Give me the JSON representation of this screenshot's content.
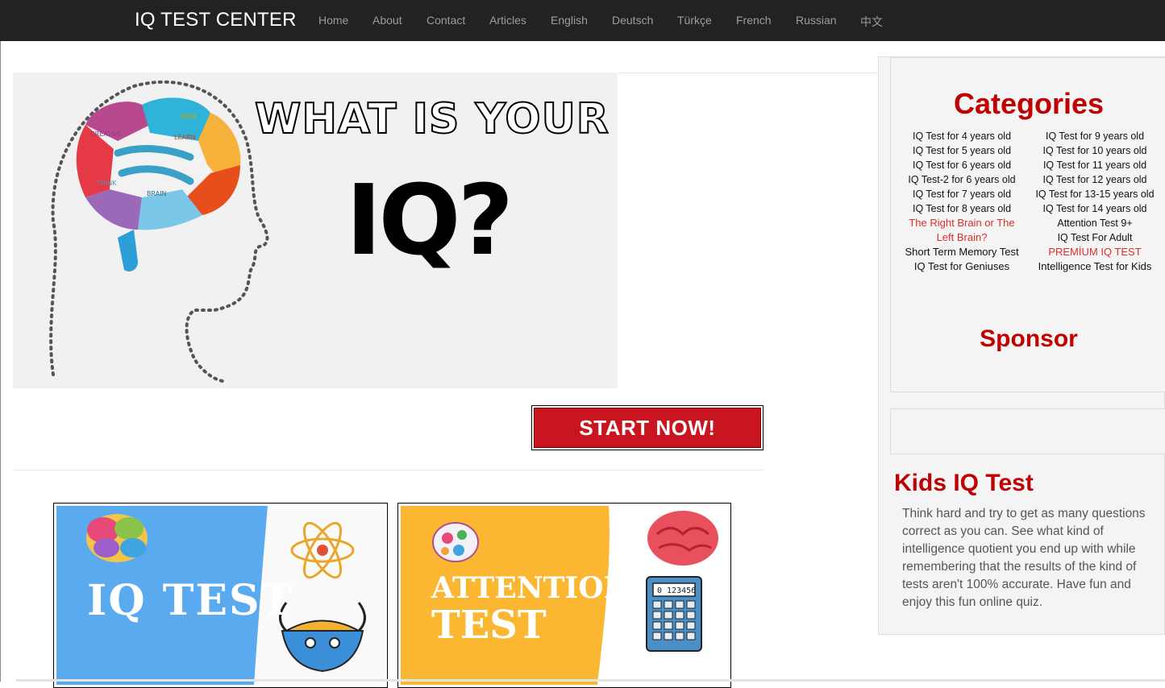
{
  "navbar": {
    "brand": "IQ TEST CENTER",
    "links": [
      "Home",
      "About",
      "Contact",
      "Articles",
      "English",
      "Deutsch",
      "Türkçe",
      "French",
      "Russian",
      "中文"
    ]
  },
  "hero": {
    "headline": "WHAT IS YOUR",
    "iq": "IQ?",
    "brain_labels": [
      "IDEA",
      "CREATIVE",
      "LEARN",
      "THINK",
      "BRAIN"
    ]
  },
  "start_button": {
    "label": "START NOW!"
  },
  "cards": [
    {
      "title_line1": "IQ TEST",
      "title_line2": ""
    },
    {
      "title_line1": "ATTENTION",
      "title_line2": "TEST",
      "calculator_display": "0 123456"
    }
  ],
  "sidebar": {
    "categories_heading": "Categories",
    "left_column": [
      {
        "label": "IQ Test for 4 years old",
        "highlight": false
      },
      {
        "label": "IQ Test for 5 years old",
        "highlight": false
      },
      {
        "label": "IQ Test for 6 years old",
        "highlight": false
      },
      {
        "label": "IQ Test-2 for 6 years old",
        "highlight": false
      },
      {
        "label": "IQ Test for 7 years old",
        "highlight": false
      },
      {
        "label": "IQ Test for 8 years old",
        "highlight": false
      },
      {
        "label": "The Right Brain or The Left Brain?",
        "highlight": true
      },
      {
        "label": "Short Term Memory Test",
        "highlight": false
      },
      {
        "label": "IQ Test for Geniuses",
        "highlight": false
      }
    ],
    "right_column": [
      {
        "label": "IQ Test for 9 years old",
        "highlight": false
      },
      {
        "label": "IQ Test for 10 years old",
        "highlight": false
      },
      {
        "label": "IQ Test for 11 years old",
        "highlight": false
      },
      {
        "label": "IQ Test for 12 years old",
        "highlight": false
      },
      {
        "label": "IQ Test for 13-15 years old",
        "highlight": false
      },
      {
        "label": "IQ Test for 14 years old",
        "highlight": false
      },
      {
        "label": "Attention Test 9+",
        "highlight": false
      },
      {
        "label": "IQ Test For Adult",
        "highlight": false
      },
      {
        "label": "PREMİUM IQ TEST",
        "highlight": true
      },
      {
        "label": "Intelligence Test for Kids",
        "highlight": false
      }
    ],
    "sponsor_heading": "Sponsor",
    "kids_title": "Kids IQ Test",
    "kids_text": "Think hard and try to get as many questions correct as you can. See what kind of intelligence quotient you end up with while remembering that the results of the kind of tests aren't 100% accurate. Have fun and enjoy this fun online quiz."
  },
  "colors": {
    "navbar_bg": "#222222",
    "accent_red": "#c00000",
    "button_red": "#c8151f",
    "card1_blue": "#5aaaf0",
    "card2_yellow": "#fbb731"
  }
}
